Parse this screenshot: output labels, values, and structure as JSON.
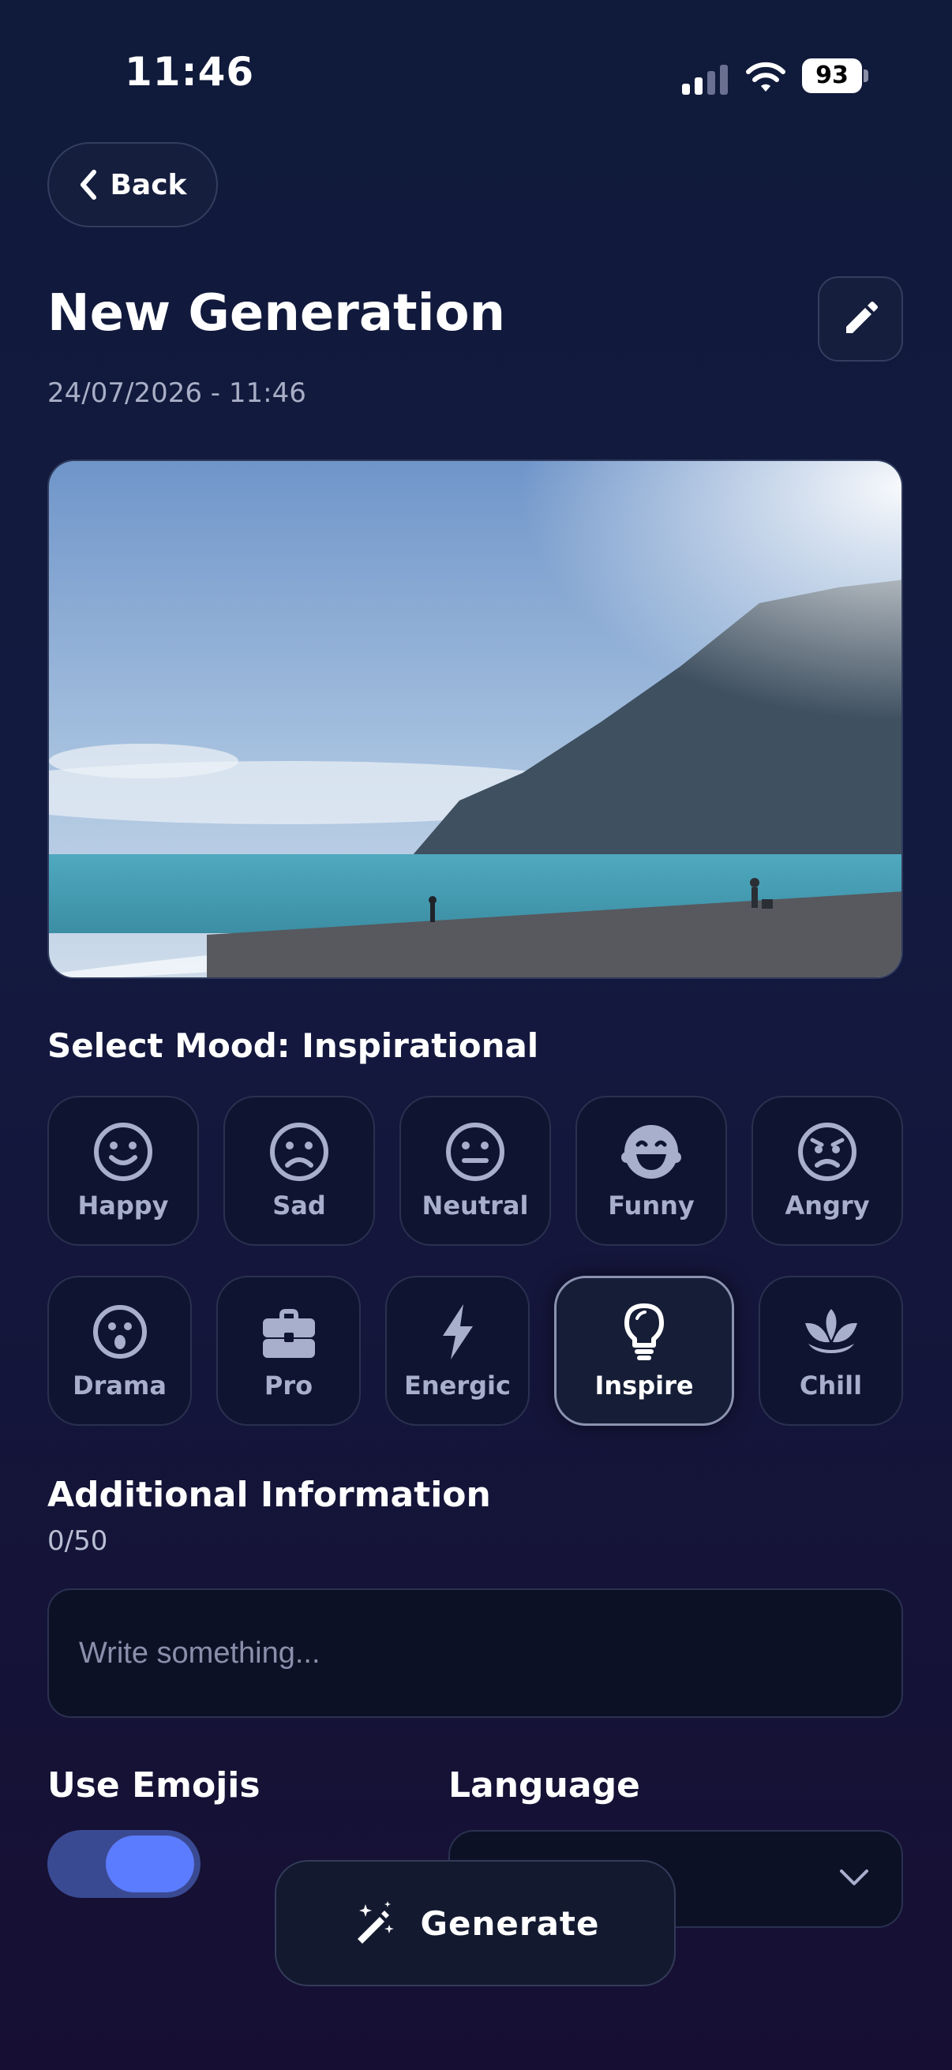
{
  "status_bar": {
    "time": "11:46",
    "battery": "93"
  },
  "header": {
    "back_label": "Back",
    "title": "New Generation",
    "date": "24/07/2026 - 11:46"
  },
  "mood_section": {
    "title": "Select Mood: Inspirational",
    "row1": [
      {
        "label": "Happy",
        "icon": "smile-icon"
      },
      {
        "label": "Sad",
        "icon": "frown-icon"
      },
      {
        "label": "Neutral",
        "icon": "neutral-face-icon"
      },
      {
        "label": "Funny",
        "icon": "laughing-face-icon"
      },
      {
        "label": "Angry",
        "icon": "angry-face-icon"
      }
    ],
    "row2": [
      {
        "label": "Drama",
        "icon": "surprised-face-icon"
      },
      {
        "label": "Pro",
        "icon": "briefcase-icon"
      },
      {
        "label": "Energic",
        "icon": "lightning-icon"
      },
      {
        "label": "Inspire",
        "icon": "lightbulb-icon",
        "selected": true
      },
      {
        "label": "Chill",
        "icon": "lotus-icon"
      }
    ]
  },
  "additional_info": {
    "title": "Additional Information",
    "counter": "0/50",
    "placeholder": "Write something..."
  },
  "options": {
    "emojis_label": "Use Emojis",
    "emojis_on": true,
    "language_label": "Language"
  },
  "generate_label": "Generate",
  "colors": {
    "accent": "#5b7cff",
    "background": "#131a40"
  }
}
